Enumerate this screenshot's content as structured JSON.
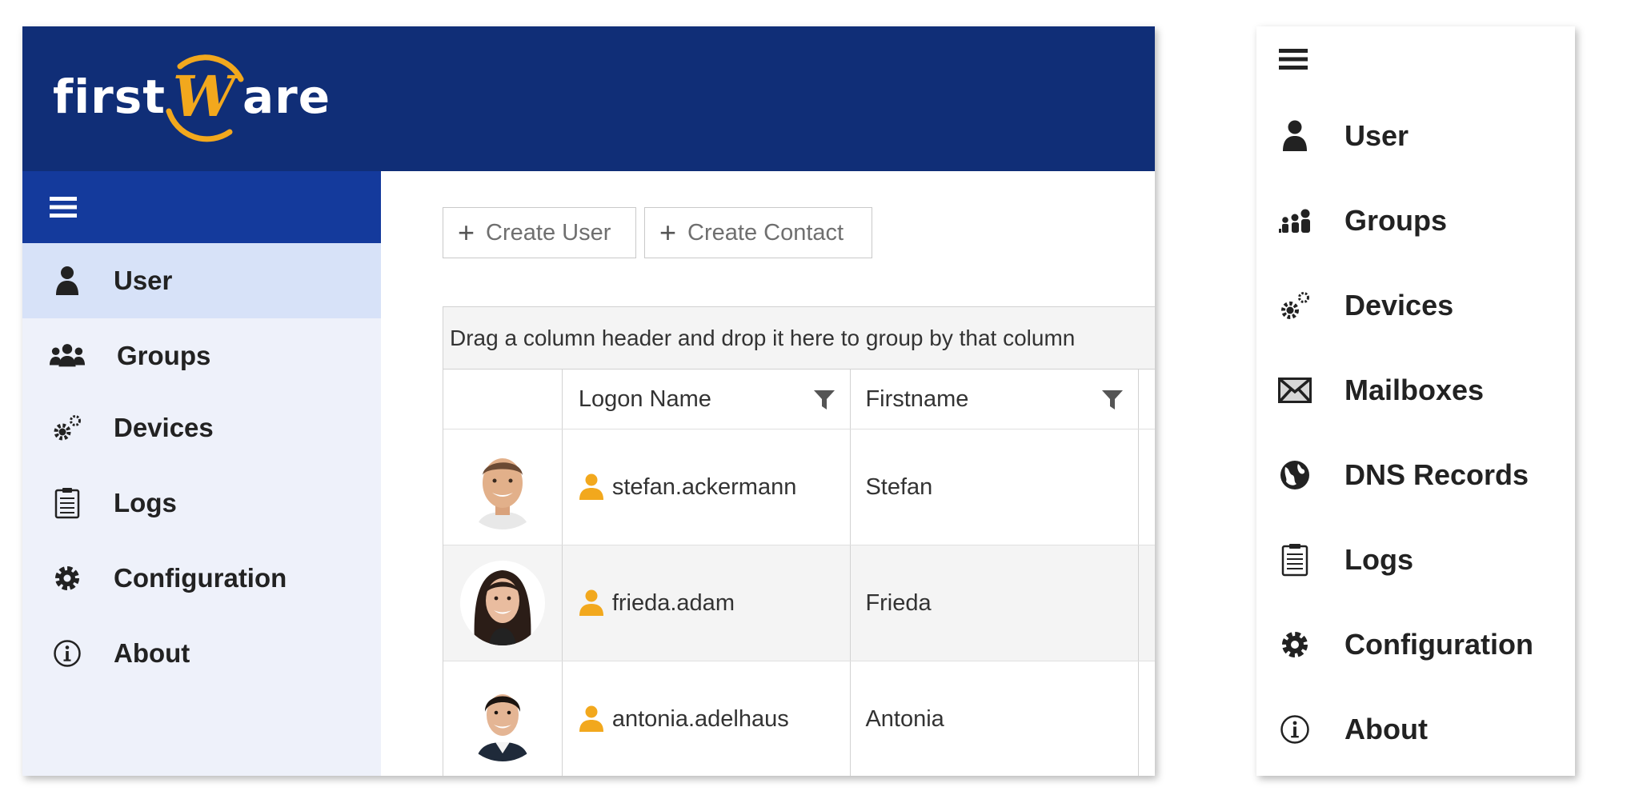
{
  "app": {
    "logo": {
      "text_left": "first",
      "text_mid": "W",
      "text_right": "are"
    },
    "colors": {
      "header": "#102e77",
      "sidebar_toggle": "#143a9c",
      "sidebar_bg": "#eef1fa",
      "active_item": "#d7e2f8",
      "accent": "#f2a81d"
    },
    "sidebar": {
      "items": [
        {
          "label": "User",
          "icon": "user-icon",
          "active": true
        },
        {
          "label": "Groups",
          "icon": "groups-icon",
          "active": false
        },
        {
          "label": "Devices",
          "icon": "devices-icon",
          "active": false
        },
        {
          "label": "Logs",
          "icon": "logs-icon",
          "active": false
        },
        {
          "label": "Configuration",
          "icon": "gear-icon",
          "active": false
        },
        {
          "label": "About",
          "icon": "info-icon",
          "active": false
        }
      ]
    },
    "toolbar": {
      "create_user": "Create User",
      "create_contact": "Create Contact"
    },
    "grid": {
      "group_hint": "Drag a column header and drop it here to group by that column",
      "columns": [
        "",
        "Logon Name",
        "Firstname"
      ],
      "rows": [
        {
          "logon": "stefan.ackermann",
          "firstname": "Stefan"
        },
        {
          "logon": "frieda.adam",
          "firstname": "Frieda"
        },
        {
          "logon": "antonia.adelhaus",
          "firstname": "Antonia"
        }
      ]
    }
  },
  "menu": {
    "items": [
      {
        "label": "User",
        "icon": "user-icon"
      },
      {
        "label": "Groups",
        "icon": "groups-icon"
      },
      {
        "label": "Devices",
        "icon": "devices-icon"
      },
      {
        "label": "Mailboxes",
        "icon": "envelope-icon"
      },
      {
        "label": "DNS Records",
        "icon": "globe-icon"
      },
      {
        "label": "Logs",
        "icon": "logs-icon"
      },
      {
        "label": "Configuration",
        "icon": "gear-icon"
      },
      {
        "label": "About",
        "icon": "info-icon"
      }
    ]
  }
}
